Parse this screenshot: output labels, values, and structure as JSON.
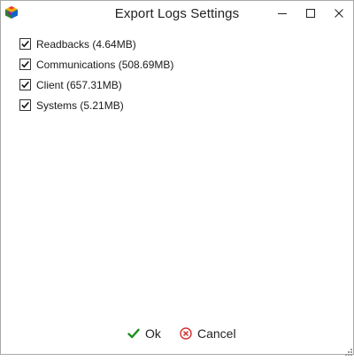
{
  "window": {
    "title": "Export Logs Settings",
    "app_icon": "cube-logo-icon",
    "controls": [
      "minimize-icon",
      "maximize-icon",
      "close-icon"
    ]
  },
  "options": [
    {
      "label": "Readbacks (4.64MB)",
      "checked": true
    },
    {
      "label": "Communications (508.69MB)",
      "checked": true
    },
    {
      "label": "Client (657.31MB)",
      "checked": true
    },
    {
      "label": "Systems (5.21MB)",
      "checked": true
    }
  ],
  "footer": {
    "ok_label": "Ok",
    "ok_icon": "checkmark-icon",
    "cancel_label": "Cancel",
    "cancel_icon": "cancel-circle-icon"
  },
  "colors": {
    "ok_icon": "#1e8f1e",
    "cancel_icon": "#d32f2f",
    "border": "#a9a9a9"
  }
}
